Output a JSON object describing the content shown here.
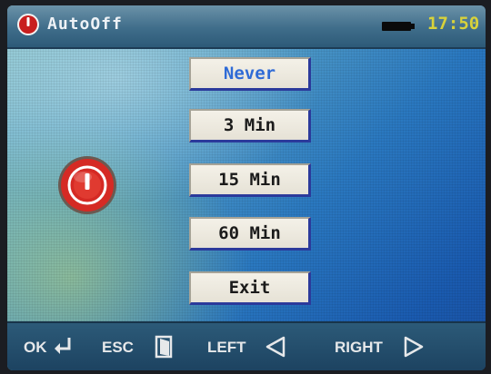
{
  "header": {
    "title": "AutoOff",
    "time": "17:50"
  },
  "menu": {
    "items": [
      {
        "label": "Never",
        "selected": true
      },
      {
        "label": "3 Min",
        "selected": false
      },
      {
        "label": "15 Min",
        "selected": false
      },
      {
        "label": "60 Min",
        "selected": false
      },
      {
        "label": "Exit",
        "selected": false
      }
    ]
  },
  "footer": {
    "ok": "OK",
    "esc": "ESC",
    "left": "LEFT",
    "right": "RIGHT"
  },
  "colors": {
    "clock": "#d8d23a",
    "selected_text": "#2f6bd6",
    "icon_red": "#c81e1e"
  },
  "icons": {
    "header": "power-icon",
    "battery": "battery-icon",
    "ok": "enter-arrow-icon",
    "esc": "door-exit-icon",
    "left": "triangle-left-icon",
    "right": "triangle-right-icon"
  }
}
